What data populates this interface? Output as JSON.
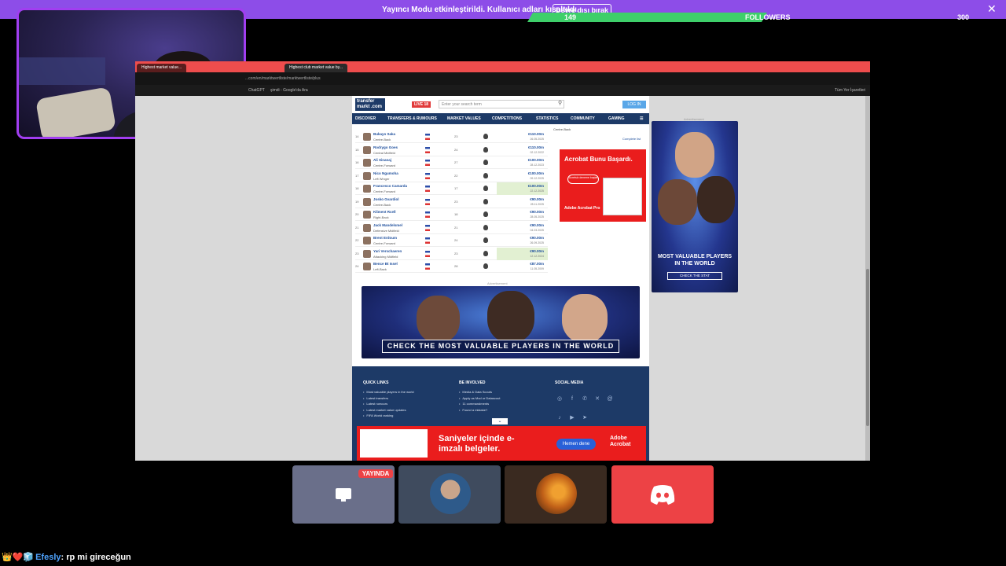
{
  "streamer_bar": {
    "message": "Yayıncı Modu etkinleştirildi. Kullanıcı adları kısaltıldı.",
    "disable_button": "Devre dışı bırak",
    "close_icon": "close-icon",
    "color": "#8d4de8"
  },
  "followers_bar": {
    "current": "149",
    "label": "FOLLOWERS",
    "goal": "300",
    "progress": 0.497,
    "fill_color": "#3ecf6a"
  },
  "browser": {
    "tabs": [
      "Highest market value...",
      "Highest club market value by..."
    ],
    "url": "...com/en/marktwertliste/marktwertliste/plus",
    "bookmarks": [
      "ChatGPT",
      "şimdi - Google'da Ara",
      "Tüm Yer İşaretleri"
    ]
  },
  "site": {
    "logo": "transfer markt .com",
    "live_badge": "LIVE 18",
    "search_placeholder": "Enter your search term",
    "login": "LOG IN",
    "nav": [
      "DISCOVER",
      "TRANSFERS & RUMOURS",
      "MARKET VALUES",
      "COMPETITIONS",
      "STATISTICS",
      "COMMUNITY",
      "GAMING"
    ],
    "rows": [
      {
        "num": "14",
        "name": "Bukayo Saka",
        "pos": "Centre-Back",
        "age": "23",
        "value": "€110.00m",
        "date": "26.05.2025",
        "hl": false
      },
      {
        "num": "15",
        "name": "Rodrygo Goes",
        "pos": "Central Midfield",
        "age": "24",
        "value": "€110.00m",
        "date": "02.12.2022",
        "hl": false
      },
      {
        "num": "16",
        "name": "Ali Sinanaj",
        "pos": "Centre-Forward",
        "age": "27",
        "value": "€100.00m",
        "date": "28.12.2023",
        "hl": false
      },
      {
        "num": "17",
        "name": "Nico Ngumoha",
        "pos": "Left Winger",
        "age": "22",
        "value": "€100.00m",
        "date": "09.12.2025",
        "hl": false
      },
      {
        "num": "18",
        "name": "Francesco Camarda",
        "pos": "Centre-Forward",
        "age": "17",
        "value": "€100.00m",
        "date": "22.12.2025",
        "hl": true
      },
      {
        "num": "19",
        "name": "Josko Gvardiol",
        "pos": "Centre-Back",
        "age": "23",
        "value": "€90.00m",
        "date": "28.11.2025",
        "hl": false
      },
      {
        "num": "20",
        "name": "Kliment Rcell",
        "pos": "Right-Back",
        "age": "18",
        "value": "€90.00m",
        "date": "28.05.2025",
        "hl": false
      },
      {
        "num": "21",
        "name": "Jack Mandelsmel",
        "pos": "Defensive Midfield",
        "age": "21",
        "value": "€90.00m",
        "date": "04.03.2025",
        "hl": false
      },
      {
        "num": "22",
        "name": "Brent Erdoum",
        "pos": "Centre-Forward",
        "age": "24",
        "value": "€90.00m",
        "date": "26.09.2025",
        "hl": false
      },
      {
        "num": "23",
        "name": "Yari Verschaeren",
        "pos": "Attacking Midfield",
        "age": "23",
        "value": "€90.00m",
        "date": "12.12.2024",
        "hl": true
      },
      {
        "num": "24",
        "name": "Bence Bt Issel",
        "pos": "Left-Back",
        "age": "28",
        "value": "€87.00m",
        "date": "11.05.2009",
        "hl": false
      }
    ],
    "pager": [
      "1",
      "2",
      "3",
      "4",
      "5",
      "6",
      "8"
    ],
    "side_list_item": "Centre-Back",
    "side_list_link": "Complete list",
    "ad_label": "Advertisement",
    "acrobat_ad": {
      "headline": "Acrobat Bunu Başardı.",
      "button": "Ücretsiz deneme başlat",
      "brand": "Adobe Acrobat Pro"
    },
    "wide_ad_cta": "CHECK THE MOST VALUABLE PLAYERS IN THE WORLD",
    "tall_ad": {
      "title": "MOST VALUABLE PLAYERS IN THE WORLD",
      "button": "CHECK THE STAT"
    },
    "footer": {
      "quick_links_title": "QUICK LINKS",
      "quick_links": [
        "Most valuable players in the world",
        "Latest transfers",
        "Latest rumours",
        "Latest market value updates",
        "FIFA World ranking"
      ],
      "involved_title": "BE INVOLVED",
      "involved": [
        "Media & Data Scouts",
        "Apply as Mod or Datascout",
        "11 commandments",
        "Found a mistake?"
      ],
      "social_title": "SOCIAL MEDIA",
      "social_icons": [
        "instagram-icon",
        "facebook-icon",
        "whatsapp-icon",
        "x-icon",
        "threads-icon",
        "tiktok-icon",
        "youtube-icon",
        "telegram-icon"
      ]
    },
    "esign_ad": {
      "text": "Saniyeler içinde e-imzalı belgeler.",
      "button": "Hemen dene",
      "brand": "Adobe Acrobat"
    }
  },
  "participants": {
    "live_badge": "YAYINDA",
    "discord_color": "#ed4245"
  },
  "chat": {
    "emotes": "👑❤️🧊",
    "user": "Efesly",
    "message": "rp mi gireceğun"
  }
}
